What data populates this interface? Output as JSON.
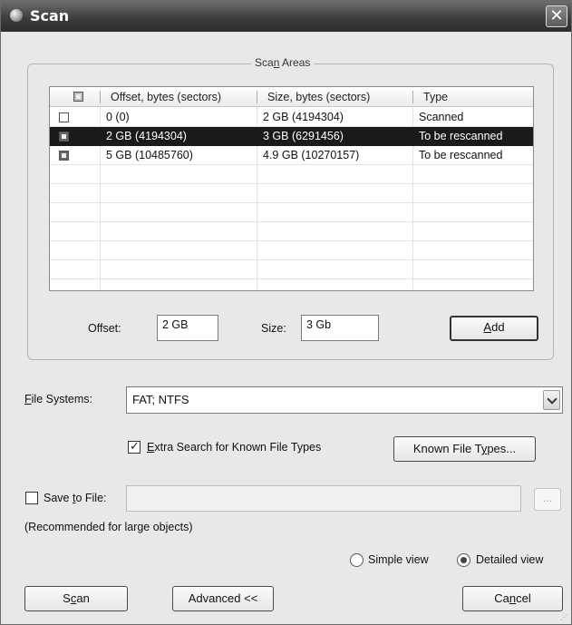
{
  "window": {
    "title": "Scan",
    "close_label": "✕"
  },
  "scan_areas": {
    "legend": "Scan Areas",
    "columns": [
      "Offset, bytes (sectors)",
      "Size, bytes (sectors)",
      "Type"
    ],
    "rows": [
      {
        "checked": false,
        "offset": "0 (0)",
        "size": "2 GB (4194304)",
        "type": "Scanned",
        "selected": false
      },
      {
        "checked": true,
        "offset": "2 GB (4194304)",
        "size": "3 GB (6291456)",
        "type": "To be rescanned",
        "selected": true
      },
      {
        "checked": true,
        "offset": "5 GB (10485760)",
        "size": "4.9 GB (10270157)",
        "type": "To be rescanned",
        "selected": false
      }
    ],
    "offset_label": "Offset:",
    "offset_value": "2 GB",
    "size_label": "Size:",
    "size_value": "3 Gb",
    "add_label": "Add"
  },
  "file_systems": {
    "label": "File Systems:",
    "value": "FAT; NTFS"
  },
  "extra_search": {
    "label": "Extra Search for Known File Types",
    "checked": true,
    "known_types_button": "Known File Types..."
  },
  "save_to_file": {
    "label": "Save to File:",
    "checked": false,
    "browse_label": "...",
    "hint": "(Recommended for large objects)"
  },
  "view": {
    "simple_label": "Simple view",
    "detailed_label": "Detailed view",
    "selected": "detailed"
  },
  "buttons": {
    "scan": "Scan",
    "advanced": "Advanced <<",
    "cancel": "Cancel"
  }
}
